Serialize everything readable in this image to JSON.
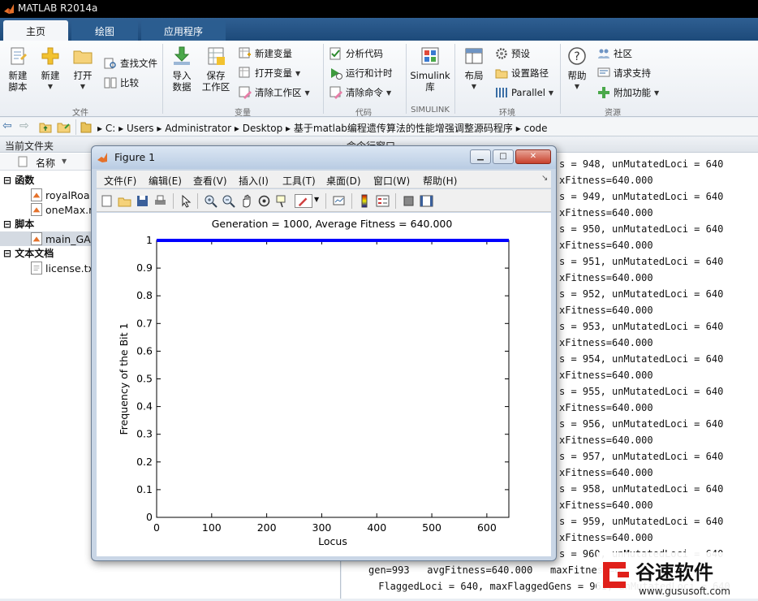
{
  "app": {
    "title": "MATLAB R2014a"
  },
  "ribbon": {
    "tabs": [
      {
        "label": "主页"
      },
      {
        "label": "绘图"
      },
      {
        "label": "应用程序"
      }
    ],
    "groups": {
      "file": {
        "label": "文件",
        "new_script": "新建\n脚本",
        "new": "新建",
        "open": "打开",
        "find_files": "查找文件",
        "compare": "比较"
      },
      "variable": {
        "label": "变量",
        "import_data": "导入\n数据",
        "save_workspace": "保存\n工作区",
        "new_variable": "新建变量",
        "open_variable": "打开变量",
        "clear_workspace": "清除工作区"
      },
      "code": {
        "label": "代码",
        "analyze_code": "分析代码",
        "run_and_time": "运行和计时",
        "clear_commands": "清除命令"
      },
      "simulink": {
        "label": "SIMULINK",
        "library": "Simulink\n库"
      },
      "environment": {
        "label": "环境",
        "layout": "布局",
        "preferences": "预设",
        "set_path": "设置路径",
        "parallel": "Parallel"
      },
      "resources": {
        "label": "资源",
        "help": "帮助",
        "community": "社区",
        "request_support": "请求支持",
        "add_ons": "附加功能"
      }
    }
  },
  "address": {
    "segments": [
      "C:",
      "Users",
      "Administrator",
      "Desktop",
      "基于matlab编程遗传算法的性能增强调整源码程序",
      "code"
    ]
  },
  "current_folder": {
    "header": "当前文件夹",
    "column_name": "名称",
    "sections": [
      {
        "label": "函数",
        "items": [
          "royalRoad.m",
          "oneMax.m"
        ]
      },
      {
        "label": "脚本",
        "items": [
          "main_GA.m"
        ]
      },
      {
        "label": "文本文档",
        "items": [
          "license.txt"
        ]
      }
    ],
    "visible_item_text": [
      "royalRoa",
      "oneMax.r",
      "main_GA.",
      "license.txt"
    ]
  },
  "command_window": {
    "header": "命令行窗口",
    "lines": [
      "s = 948, unMutatedLoci = 640",
      "xFitness=640.000",
      "s = 949, unMutatedLoci = 640",
      "xFitness=640.000",
      "s = 950, unMutatedLoci = 640",
      "xFitness=640.000",
      "s = 951, unMutatedLoci = 640",
      "xFitness=640.000",
      "s = 952, unMutatedLoci = 640",
      "xFitness=640.000",
      "s = 953, unMutatedLoci = 640",
      "xFitness=640.000",
      "s = 954, unMutatedLoci = 640",
      "xFitness=640.000",
      "s = 955, unMutatedLoci = 640",
      "xFitness=640.000",
      "s = 956, unMutatedLoci = 640",
      "xFitness=640.000",
      "s = 957, unMutatedLoci = 640",
      "xFitness=640.000",
      "s = 958, unMutatedLoci = 640",
      "xFitness=640.000",
      "s = 959, unMutatedLoci = 640",
      "xFitness=640.000",
      "s = 960, unMutatedLoci = 640"
    ],
    "bottom_line_1": "gen=993   avgFitness=640.000   maxFitness=6",
    "bottom_line_2": " FlaggedLoci = 640, maxFlaggedGens = 961, unMutatedLoci = 640"
  },
  "figure": {
    "title": "Figure 1",
    "menu": [
      "文件(F)",
      "编辑(E)",
      "查看(V)",
      "插入(I)",
      "工具(T)",
      "桌面(D)",
      "窗口(W)",
      "帮助(H)"
    ],
    "toolbar_icons": [
      "new-figure-icon",
      "open-file-icon",
      "save-icon",
      "print-icon",
      "pointer-icon",
      "zoom-in-icon",
      "zoom-out-icon",
      "pan-icon",
      "rotate-icon",
      "data-cursor-icon",
      "brush-icon",
      "link-icon",
      "colorbar-icon",
      "legend-icon",
      "hide-plot-tools-icon",
      "show-plot-tools-icon"
    ]
  },
  "chart_data": {
    "type": "line",
    "title": "Generation = 1000, Average Fitness = 640.000",
    "xlabel": "Locus",
    "ylabel": "Frequency of the Bit 1",
    "xlim": [
      0,
      640
    ],
    "ylim": [
      0,
      1
    ],
    "xticks": [
      0,
      100,
      200,
      300,
      400,
      500,
      600
    ],
    "yticks": [
      0,
      0.1,
      0.2,
      0.3,
      0.4,
      0.5,
      0.6,
      0.7,
      0.8,
      0.9,
      1
    ],
    "ytick_labels": [
      "0",
      "0.1",
      "0.2",
      "0.3",
      "0.4",
      "0.5",
      "0.6",
      "0.7",
      "0.8",
      "0.9",
      "1"
    ],
    "series": [
      {
        "x": [
          0,
          640
        ],
        "y": [
          1,
          1
        ],
        "color": "#0000ff"
      }
    ],
    "grid": false
  },
  "watermark": {
    "text_cn": "谷速软件",
    "text_en": "www.gususoft.com"
  },
  "colors": {
    "accent": "#1d4a7a",
    "plot_line": "#0000ff",
    "watermark_red": "#e0201a"
  }
}
